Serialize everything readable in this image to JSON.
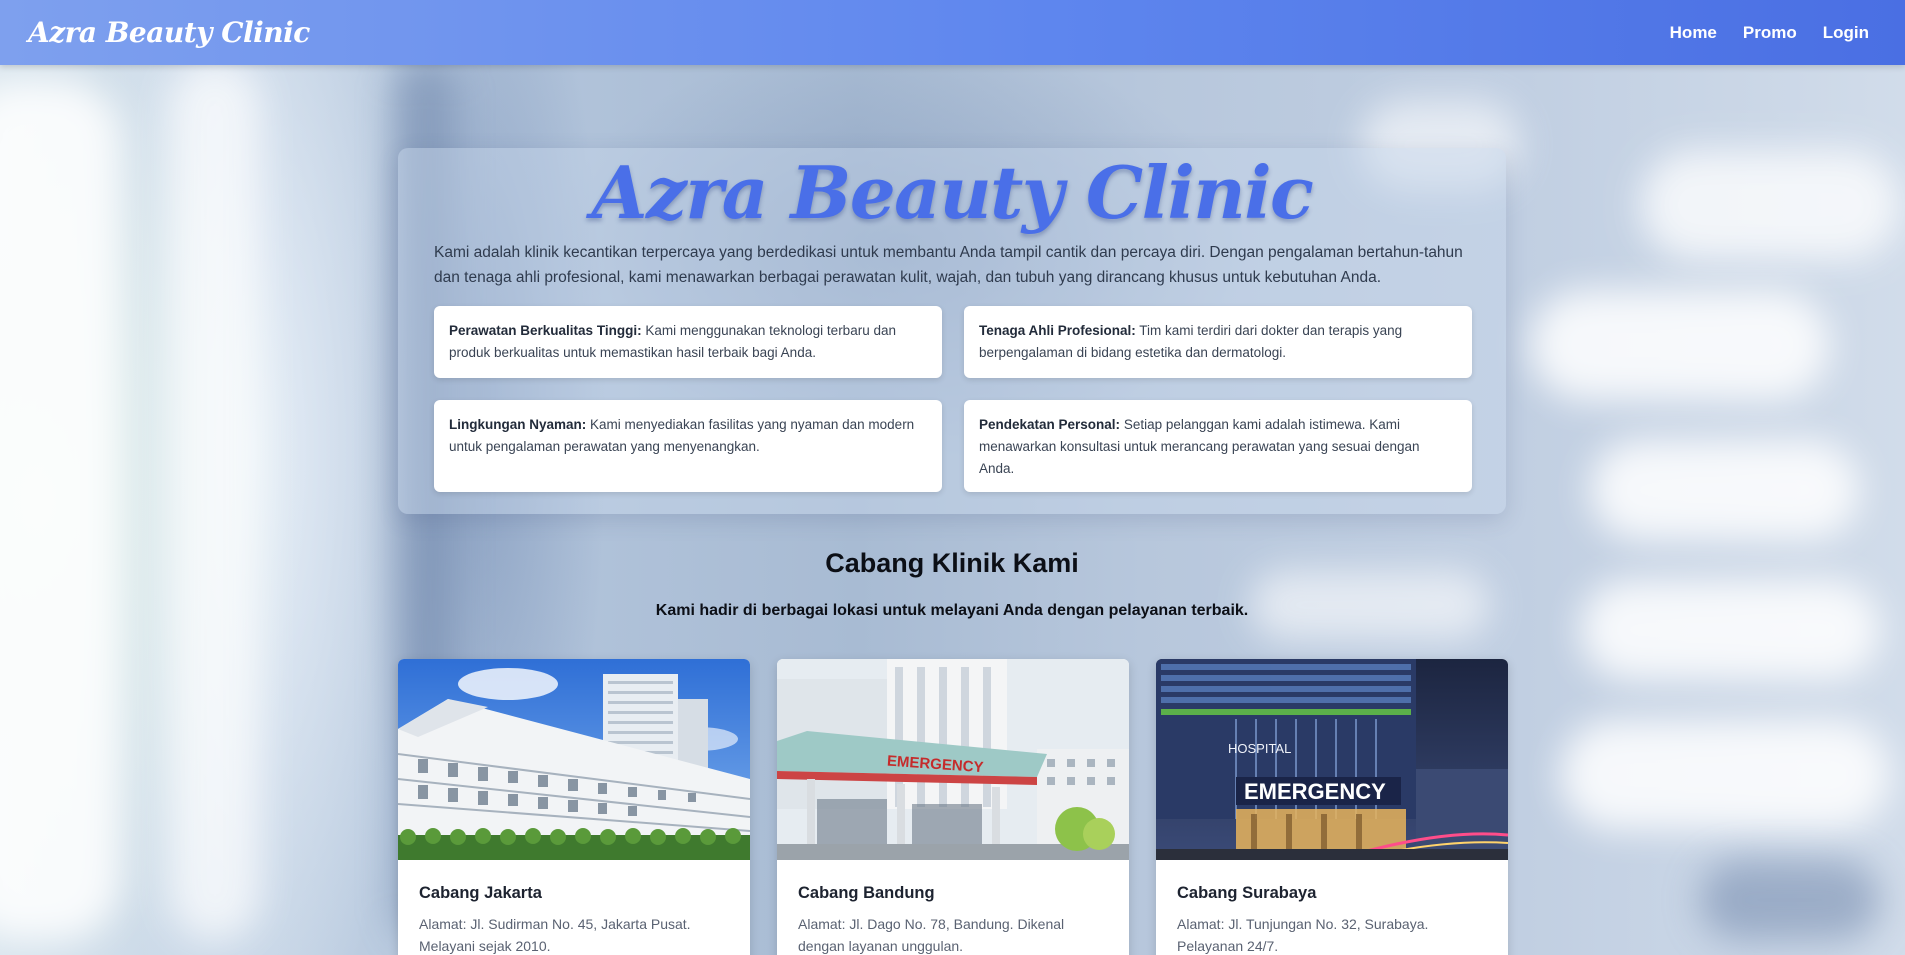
{
  "navbar": {
    "brand": "Azra Beauty Clinic",
    "links": [
      "Home",
      "Promo",
      "Login"
    ]
  },
  "hero": {
    "title": "Azra Beauty Clinic",
    "description": "Kami adalah klinik kecantikan terpercaya yang berdedikasi untuk membantu Anda tampil cantik dan percaya diri. Dengan pengalaman bertahun-tahun dan tenaga ahli profesional, kami menawarkan berbagai perawatan kulit, wajah, dan tubuh yang dirancang khusus untuk kebutuhan Anda.",
    "features": [
      {
        "title": "Perawatan Berkualitas Tinggi:",
        "text": " Kami menggunakan teknologi terbaru dan produk berkualitas untuk memastikan hasil terbaik bagi Anda."
      },
      {
        "title": "Tenaga Ahli Profesional:",
        "text": " Tim kami terdiri dari dokter dan terapis yang berpengalaman di bidang estetika dan dermatologi."
      },
      {
        "title": "Lingkungan Nyaman:",
        "text": " Kami menyediakan fasilitas yang nyaman dan modern untuk pengalaman perawatan yang menyenangkan."
      },
      {
        "title": "Pendekatan Personal:",
        "text": " Setiap pelanggan kami adalah istimewa. Kami menawarkan konsultasi untuk merancang perawatan yang sesuai dengan Anda."
      }
    ]
  },
  "branches_section": {
    "title": "Cabang Klinik Kami",
    "subtitle": "Kami hadir di berbagai lokasi untuk melayani Anda dengan pelayanan terbaik.",
    "branches": [
      {
        "name": "Cabang Jakarta",
        "text": "Alamat: Jl. Sudirman No. 45, Jakarta Pusat. Melayani sejak 2010."
      },
      {
        "name": "Cabang Bandung",
        "text": "Alamat: Jl. Dago No. 78, Bandung. Dikenal dengan layanan unggulan."
      },
      {
        "name": "Cabang Surabaya",
        "text": "Alamat: Jl. Tunjungan No. 32, Surabaya. Pelayanan 24/7."
      }
    ],
    "image_signs": {
      "bandung": "EMERGENCY",
      "surabaya_top": "HOSPITAL",
      "surabaya_main": "EMERGENCY"
    }
  },
  "colors": {
    "accent": "#4a6fe8",
    "navbar_start": "#7ea0ee",
    "navbar_end": "#4a6fe3"
  }
}
